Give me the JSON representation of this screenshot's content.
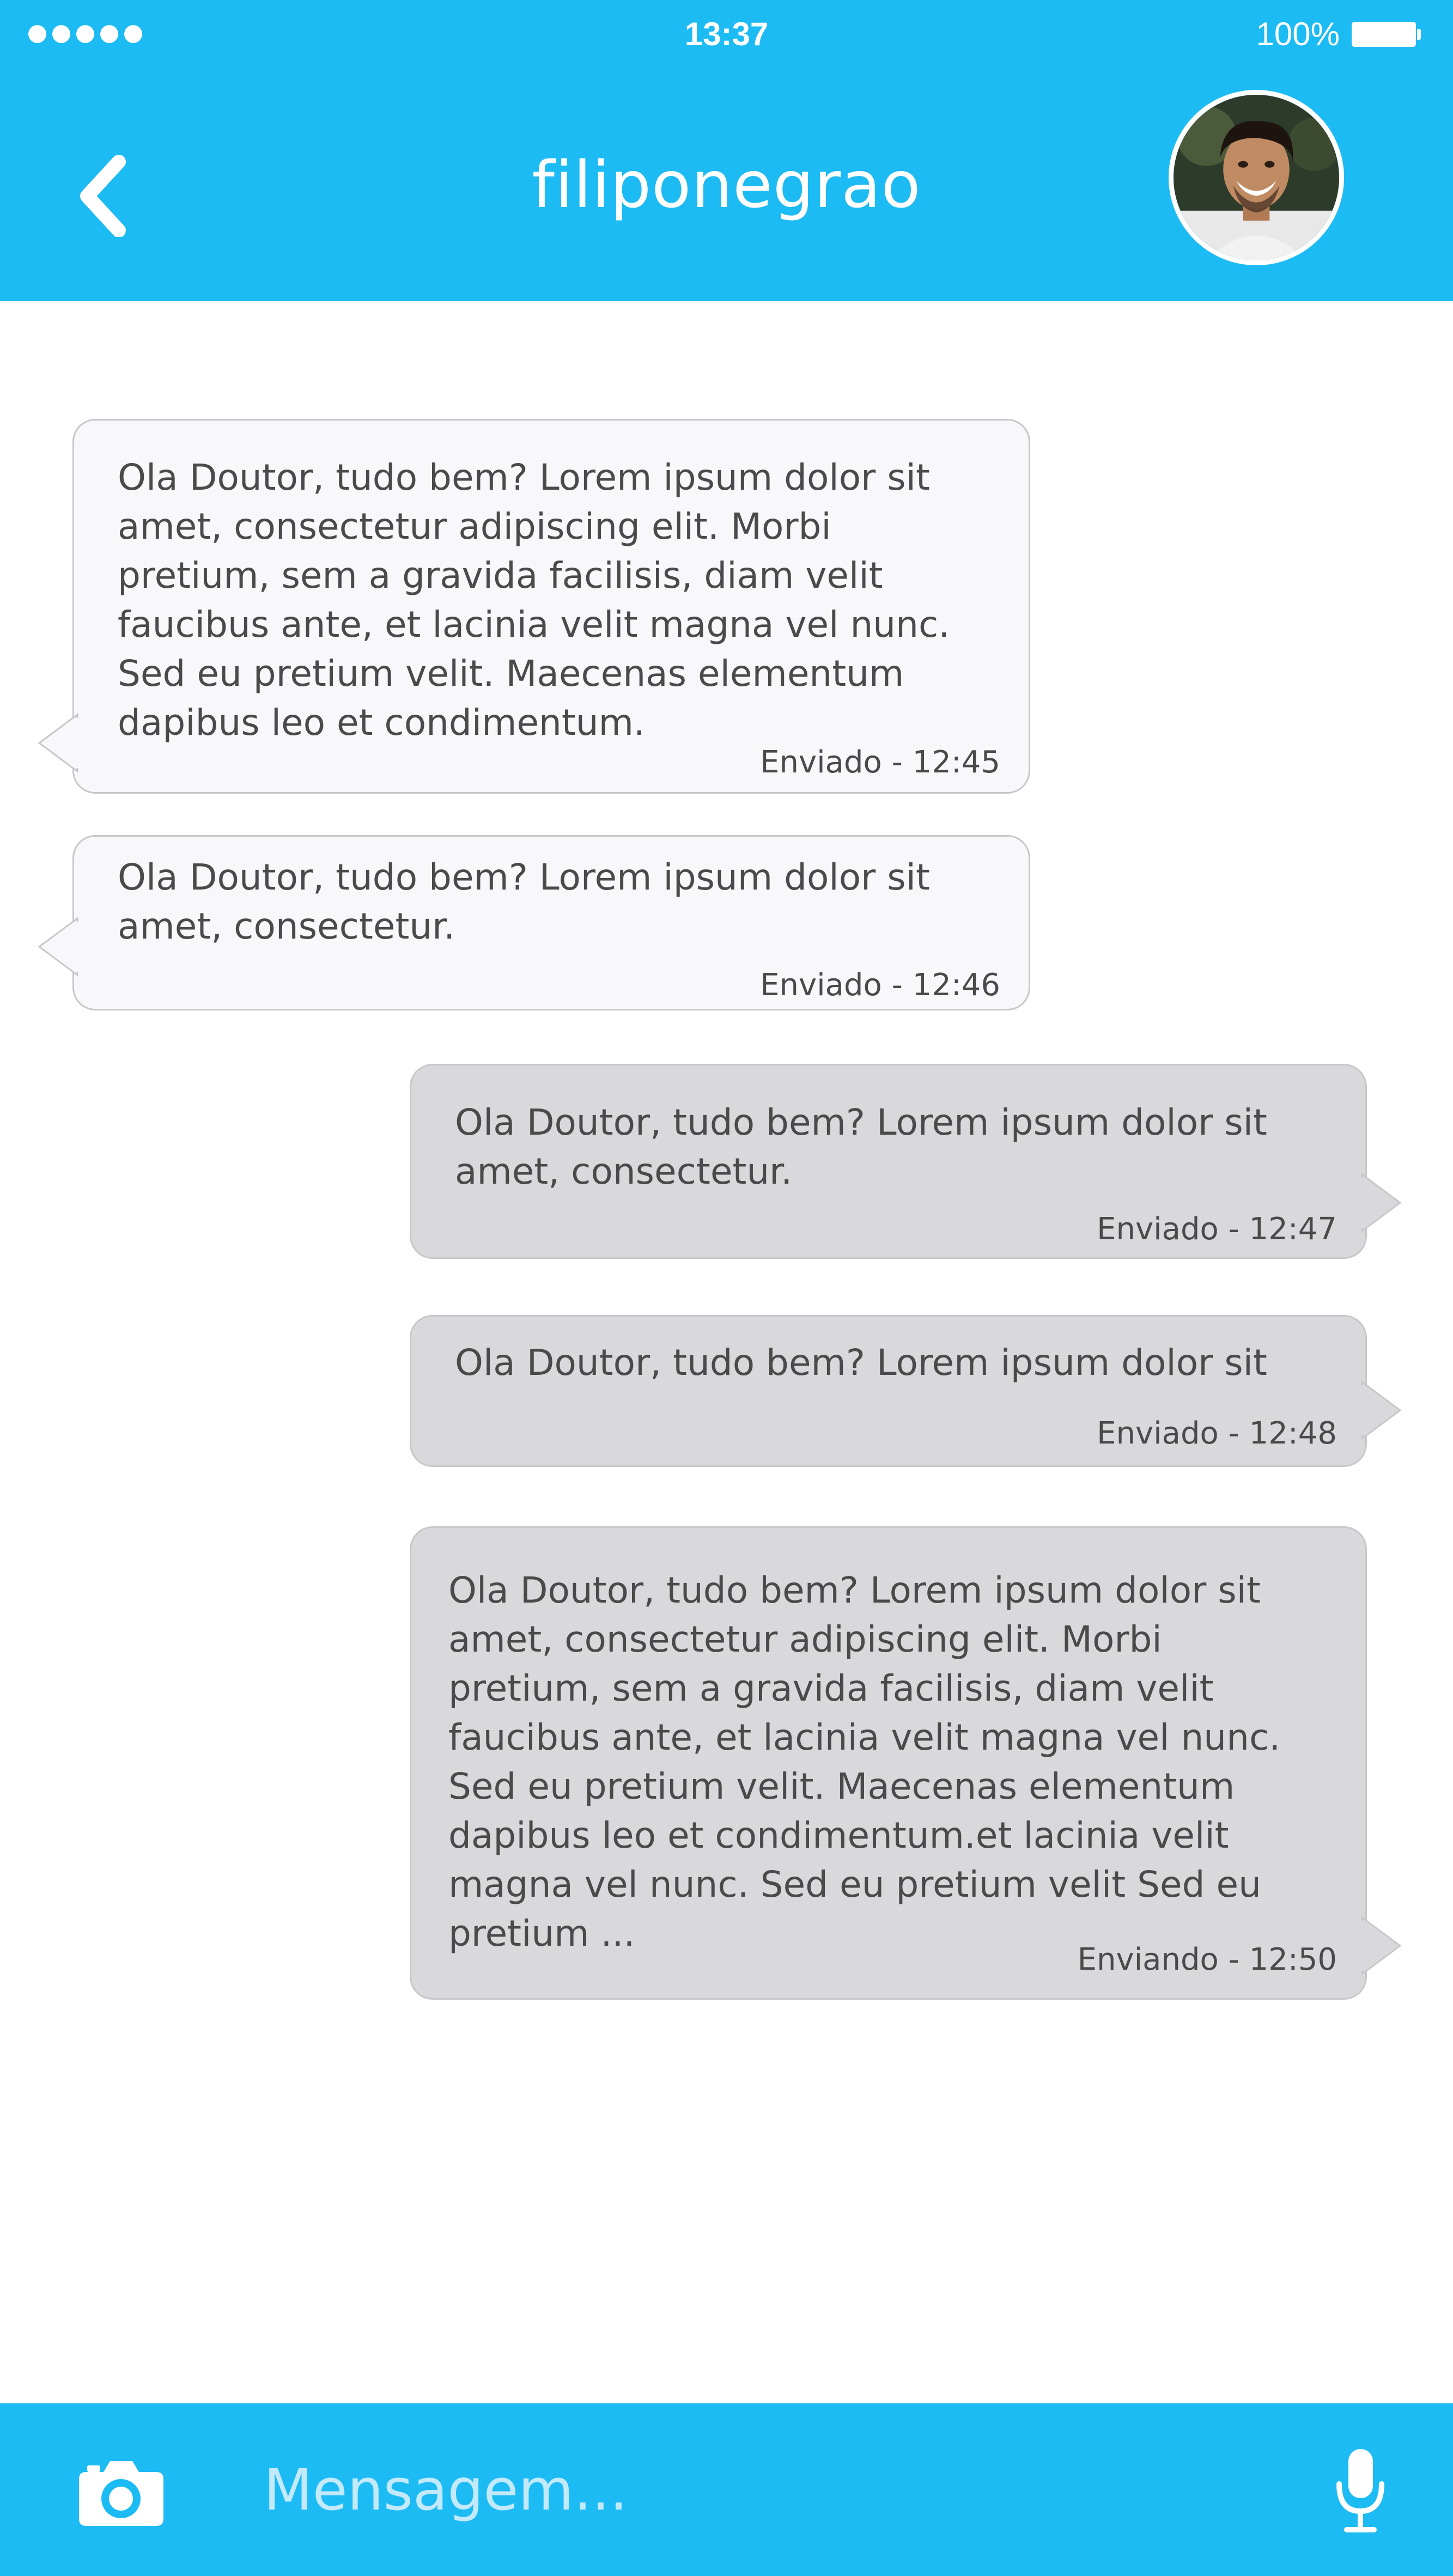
{
  "status_bar": {
    "time": "13:37",
    "battery": "100%",
    "signal_dots": 5
  },
  "header": {
    "title": "filiponegrao",
    "back_icon": "chevron-left-icon",
    "avatar": "contact-avatar-photo"
  },
  "messages": [
    {
      "direction": "incoming",
      "text": "Ola Doutor, tudo bem? Lorem ipsum dolor sit amet, consectetur adipiscing elit. Morbi pretium, sem a gravida facilisis, diam velit faucibus ante, et lacinia velit magna vel nunc. Sed eu pretium velit. Maecenas elementum dapibus leo et condimentum.",
      "status": "Enviado - 12:45"
    },
    {
      "direction": "incoming",
      "text": "Ola Doutor, tudo bem? Lorem ipsum dolor sit amet, consectetur.",
      "status": "Enviado - 12:46"
    },
    {
      "direction": "outgoing",
      "text": "Ola Doutor, tudo bem? Lorem ipsum dolor sit amet, consectetur.",
      "status": "Enviado - 12:47"
    },
    {
      "direction": "outgoing",
      "text": "Ola Doutor, tudo bem? Lorem ipsum dolor sit",
      "status": "Enviado - 12:48"
    },
    {
      "direction": "outgoing",
      "text": "Ola Doutor, tudo bem? Lorem ipsum dolor sit amet, consectetur adipiscing elit. Morbi pretium, sem a gravida facilisis, diam velit faucibus ante, et lacinia velit magna vel nunc. Sed eu pretium velit. Maecenas elementum dapibus leo et condimentum.et lacinia velit magna vel nunc. Sed eu pretium velit Sed eu pretium ...",
      "status": "Enviando - 12:50"
    }
  ],
  "composer": {
    "placeholder": "Mensagem...",
    "camera_icon": "camera-icon",
    "mic_icon": "microphone-icon"
  },
  "colors": {
    "accent": "#1dbbf3",
    "incoming_bubble": "#f8f8fa",
    "outgoing_bubble": "#d9d9dc",
    "bubble_border": "#c7c7cc",
    "text": "#4a4a4a"
  }
}
